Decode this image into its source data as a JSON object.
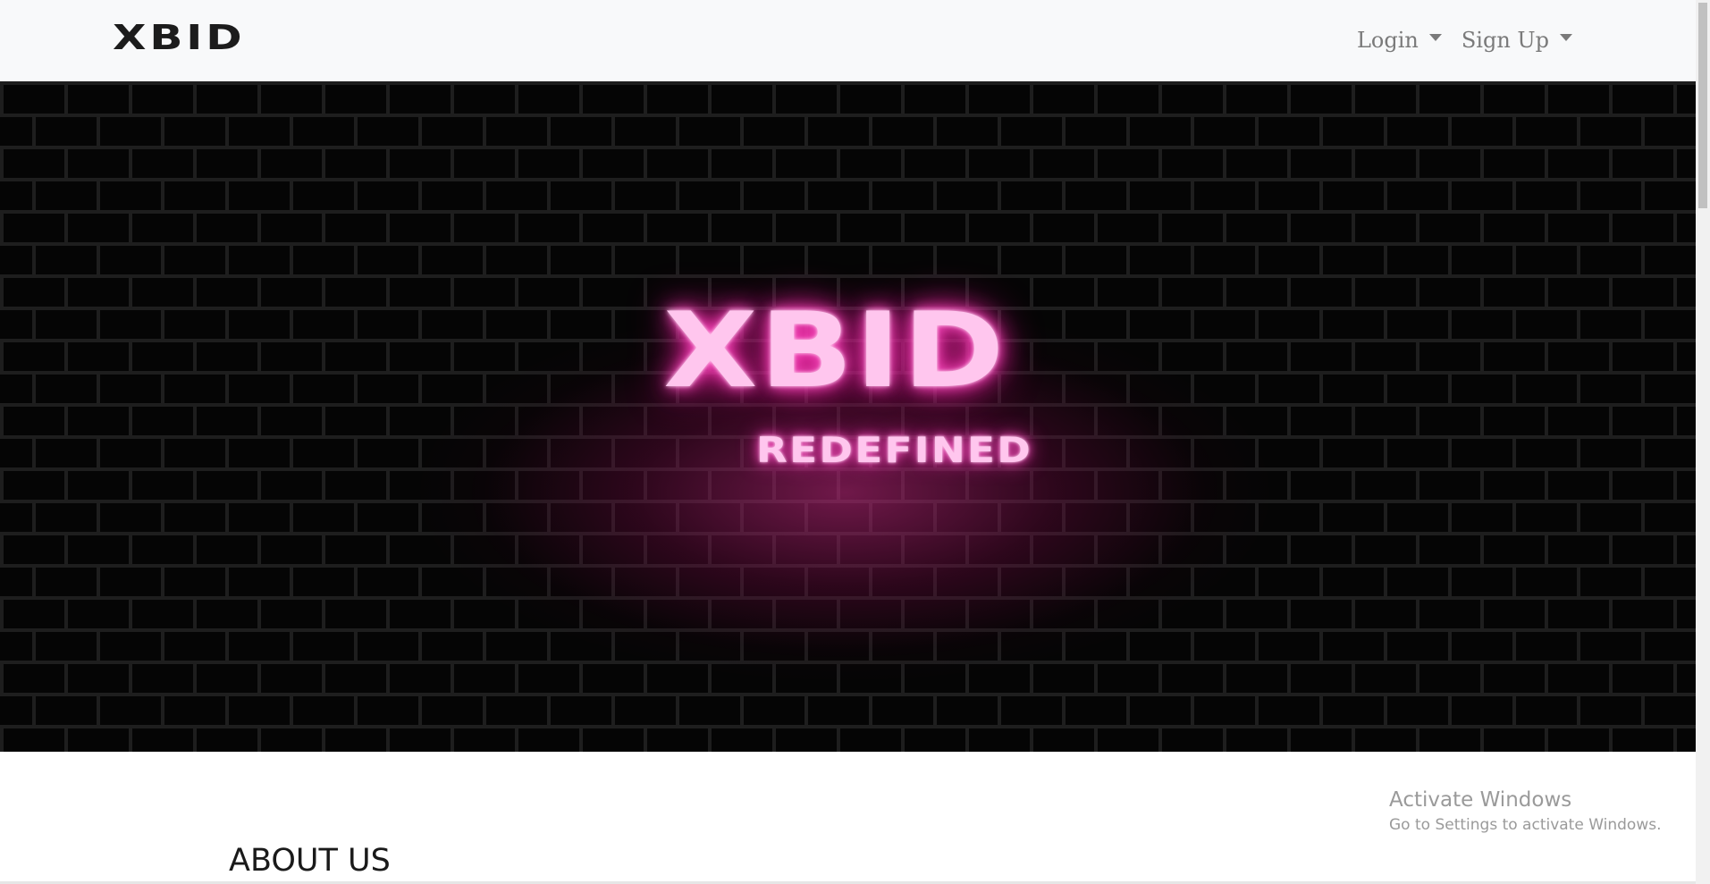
{
  "navbar": {
    "brand": "XBID",
    "menu": [
      {
        "label": "Login"
      },
      {
        "label": "Sign Up"
      }
    ]
  },
  "hero": {
    "title": "XBID",
    "subtitle": "REDEFINED",
    "colors": {
      "neon_text": "#ffc6ee",
      "neon_glow": "#ff2fb4",
      "background": "#050505"
    }
  },
  "about": {
    "heading": "ABOUT US"
  },
  "watermark": {
    "line1": "Activate Windows",
    "line2": "Go to Settings to activate Windows."
  }
}
